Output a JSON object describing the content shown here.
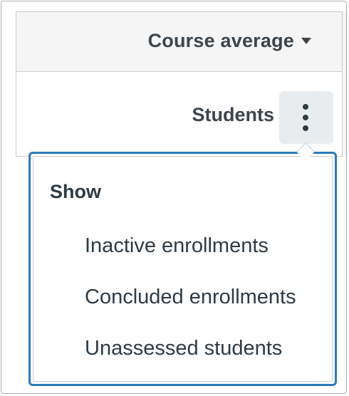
{
  "header": {
    "column_title": "Course average",
    "dropdown_icon": "triangle-down-icon"
  },
  "row": {
    "label": "Students",
    "menu_icon": "vertical-ellipsis-icon"
  },
  "menu": {
    "heading": "Show",
    "items": [
      {
        "label": "Inactive enrollments"
      },
      {
        "label": "Concluded enrollments"
      },
      {
        "label": "Unassessed students"
      }
    ]
  },
  "colors": {
    "header_bg": "#f5f5f5",
    "text": "#3d454c",
    "focus_ring": "#2b7abc",
    "border": "#c7cdd1",
    "kebab_bg": "#e9ecee"
  }
}
